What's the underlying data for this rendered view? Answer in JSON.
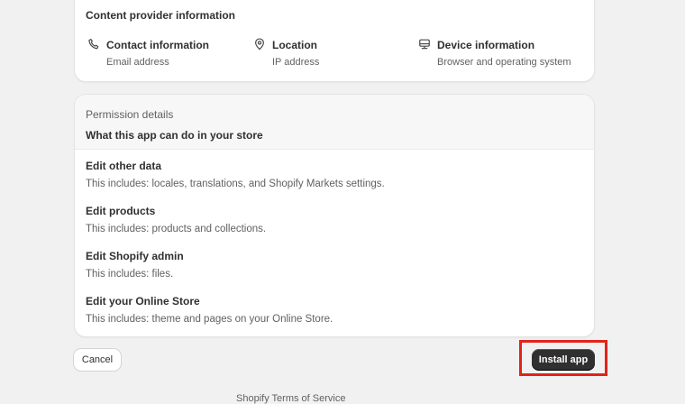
{
  "content_provider": {
    "title": "Content provider information",
    "items": [
      {
        "icon": "phone-icon",
        "label": "Contact information",
        "sub": "Email address"
      },
      {
        "icon": "location-pin-icon",
        "label": "Location",
        "sub": "IP address"
      },
      {
        "icon": "monitor-icon",
        "label": "Device information",
        "sub": "Browser and operating system"
      }
    ]
  },
  "permissions": {
    "title": "Permission details",
    "subtitle": "What this app can do in your store",
    "items": [
      {
        "title": "Edit other data",
        "desc": "This includes: locales, translations, and Shopify Markets settings."
      },
      {
        "title": "Edit products",
        "desc": "This includes: products and collections."
      },
      {
        "title": "Edit Shopify admin",
        "desc": "This includes: files."
      },
      {
        "title": "Edit your Online Store",
        "desc": "This includes: theme and pages on your Online Store."
      }
    ]
  },
  "actions": {
    "cancel_label": "Cancel",
    "install_label": "Install app"
  },
  "footer": {
    "text": "Shopify Terms of Service"
  },
  "colors": {
    "highlight": "#e32219",
    "primary_button": "#303030",
    "page_background": "#f1f1f1"
  }
}
